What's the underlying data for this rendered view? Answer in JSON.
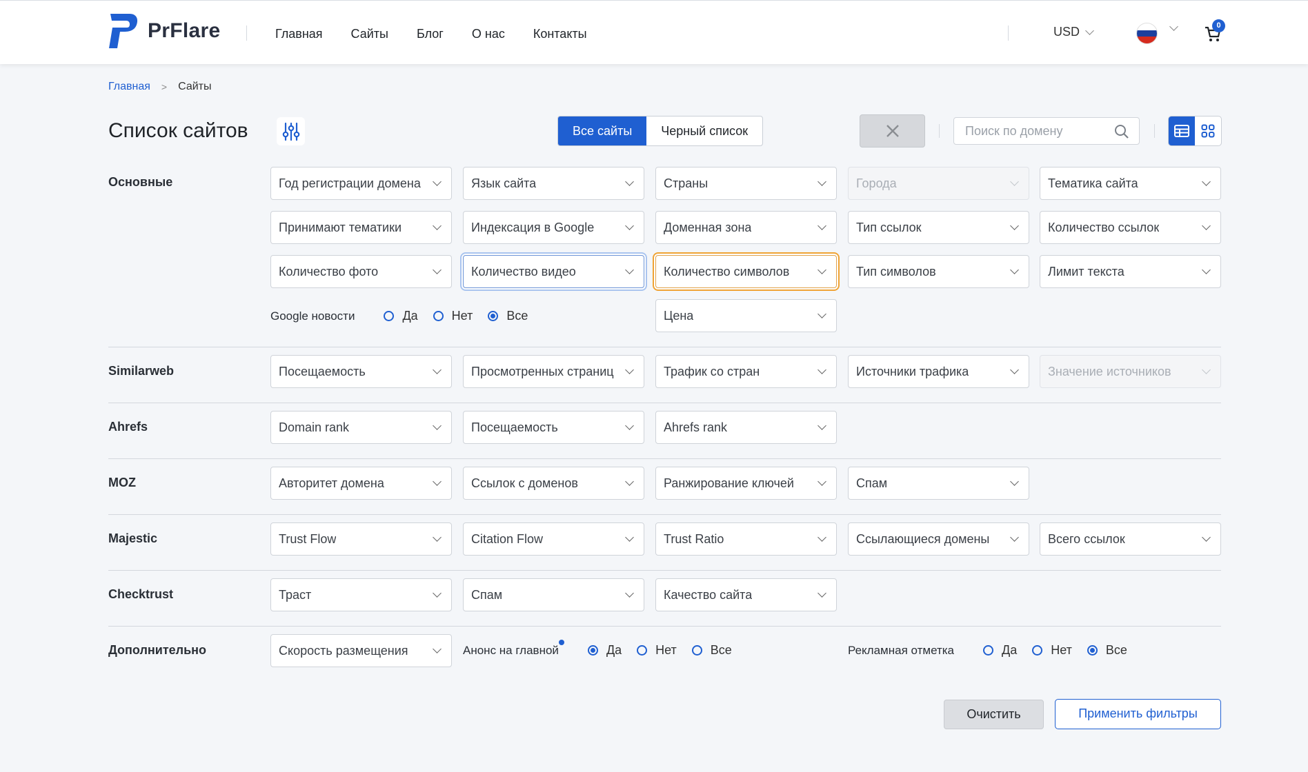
{
  "brand": {
    "name": "PrFlare",
    "accent": "#1f5fd1"
  },
  "nav": {
    "items": [
      "Главная",
      "Сайты",
      "Блог",
      "О нас",
      "Контакты"
    ]
  },
  "header": {
    "currency": "USD",
    "cart_count": "0",
    "language_flag": "russia-flag"
  },
  "breadcrumb": {
    "home": "Главная",
    "current": "Сайты"
  },
  "page": {
    "title": "Список сайтов"
  },
  "tabs": {
    "all": "Все сайты",
    "blacklist": "Черный список"
  },
  "search": {
    "placeholder": "Поиск по домену"
  },
  "sections": {
    "main": {
      "label": "Основные"
    },
    "similarweb": {
      "label": "Similarweb"
    },
    "ahrefs": {
      "label": "Ahrefs"
    },
    "moz": {
      "label": "MOZ"
    },
    "majestic": {
      "label": "Majestic"
    },
    "checktrust": {
      "label": "Checktrust"
    },
    "extra": {
      "label": "Дополнительно"
    }
  },
  "filters": {
    "main": [
      "Год регистрации домена",
      "Язык сайта",
      "Страны",
      "Города",
      "Тематика сайта",
      "Принимают тематики",
      "Индексация в Google",
      "Доменная зона",
      "Тип ссылок",
      "Количество ссылок",
      "Количество фото",
      "Количество видео",
      "Количество символов",
      "Тип символов",
      "Лимит текста",
      "Цена"
    ],
    "similarweb": [
      "Посещаемость",
      "Просмотренных страниц",
      "Трафик со стран",
      "Источники трафика",
      "Значение источников"
    ],
    "ahrefs": [
      "Domain rank",
      "Посещаемость",
      "Ahrefs rank"
    ],
    "moz": [
      "Авторитет домена",
      "Ссылок с доменов",
      "Ранжирование ключей",
      "Спам"
    ],
    "majestic": [
      "Trust Flow",
      "Citation Flow",
      "Trust Ratio",
      "Ссылающиеся домены",
      "Всего ссылок"
    ],
    "checktrust": [
      "Траст",
      "Спам",
      "Качество сайта"
    ],
    "extra": [
      "Скорость размещения"
    ]
  },
  "radios": {
    "google_news": {
      "label": "Google новости",
      "options": [
        "Да",
        "Нет",
        "Все"
      ],
      "selected": "Все"
    },
    "home_announce": {
      "label": "Анонс на главной",
      "options": [
        "Да",
        "Нет",
        "Все"
      ],
      "selected": "Да"
    },
    "ad_mark": {
      "label": "Рекламная отметка",
      "options": [
        "Да",
        "Нет",
        "Все"
      ],
      "selected": "Все"
    }
  },
  "actions": {
    "clear": "Очистить",
    "apply": "Применить фильтры"
  }
}
